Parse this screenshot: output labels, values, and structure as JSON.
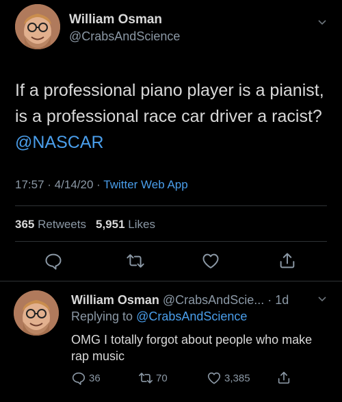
{
  "main_tweet": {
    "author_name": "William Osman",
    "author_handle": "@CrabsAndScience",
    "text_before": "If a professional piano player is a pianist, is a professional race car driver a racist? ",
    "text_mention": "@NASCAR",
    "time": "17:57",
    "date": "4/14/20",
    "separator": "·",
    "source": "Twitter Web App",
    "retweets_count": "365",
    "retweets_label": "Retweets",
    "likes_count": "5,951",
    "likes_label": "Likes"
  },
  "reply": {
    "author_name": "William Osman",
    "author_handle": "@CrabsAndScie...",
    "time": "· 1d",
    "replying_prefix": "Replying to ",
    "replying_to": "@CrabsAndScience",
    "text": "OMG I totally forgot about people who make rap music",
    "reply_count": "36",
    "retweet_count": "70",
    "like_count": "3,385"
  },
  "colors": {
    "background": "#000000",
    "text": "#d9d9d9",
    "secondary": "#8b98a5",
    "accent": "#4a9eeb",
    "divider": "#2f3336"
  },
  "icons": [
    "reply-icon",
    "retweet-icon",
    "like-icon",
    "share-icon",
    "chevron-down-icon"
  ]
}
